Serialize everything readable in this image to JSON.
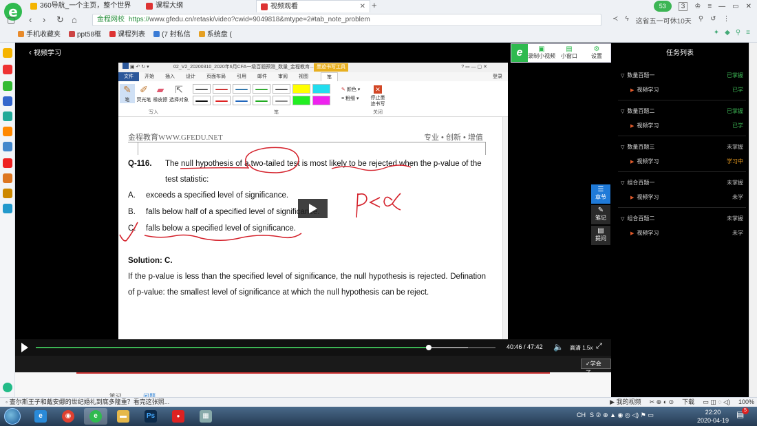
{
  "browser": {
    "tabs": [
      {
        "label": "360导航_一个主页，整个世界"
      },
      {
        "label": "课程大纲"
      },
      {
        "label": "视频观看"
      }
    ],
    "user_badge": "53",
    "tab_count": "3",
    "url_site": "金程网校",
    "url_https": "https://",
    "url_rest": "www.gfedu.cn/retask/video?cwid=9049818&mtype=2#tab_note_problem",
    "search_hint": "这省五一可休10天",
    "bookmarks": [
      "手机收藏夹",
      "ppt58框",
      "课程列表",
      "(7 封私信",
      "系统盘 ("
    ]
  },
  "player": {
    "back_label": "视频学习",
    "toolbar": {
      "record_label": "录制小视频",
      "mini_label": "小窗口",
      "settings_label": "设置"
    },
    "word": {
      "title": "02_V2_20200310_2020年6月CFA一级百题预测_数量_金程教育...",
      "pen_tools_tab": "墨迹书写工具",
      "help": "?",
      "login": "登录",
      "tabs": [
        "文件",
        "开始",
        "插入",
        "设计",
        "页面布局",
        "引用",
        "邮件",
        "审阅",
        "视图",
        "笔"
      ],
      "tools": [
        "笔",
        "荧光笔",
        "橡皮擦",
        "选择对象"
      ],
      "group_write": "写入",
      "group_pens": "笔",
      "group_close": "关闭",
      "color_opt": "颜色",
      "weight_opt": "粗细",
      "stop_label": "停止墨迹书写"
    },
    "doc": {
      "header_left": "金程教育WWW.GFEDU.NET",
      "header_right": "专业 • 创新 • 增值",
      "question_number": "Q-116.",
      "question_text": "The null hypothesis of a two-tailed test is most likely to be rejected when the p-value of the test statistic:",
      "options": [
        {
          "letter": "A.",
          "text": "exceeds a specified level of significance."
        },
        {
          "letter": "B.",
          "text": "falls below half of a specified level of significance."
        },
        {
          "letter": "C.",
          "text": "falls below a specified level of significance."
        }
      ],
      "solution_title": "Solution: C.",
      "solution_text": "If the p-value is less than the specified level of significance, the null hypothesis is rejected. Defination of p-value: the smallest level of significance at which the null hypothesis can be reject."
    },
    "controls": {
      "current_time": "40:46",
      "total_time": "47:42",
      "progress": 0.855,
      "buffered": 0.94,
      "speed_label": "高清 1.5x"
    },
    "learned_label": "✓学会了"
  },
  "side_buttons": [
    {
      "label": "章节"
    },
    {
      "label": "笔记"
    },
    {
      "label": "提问"
    }
  ],
  "task_panel": {
    "title": "任务列表",
    "groups": [
      {
        "name": "数量百题一",
        "status": "已掌握",
        "status_color": "#3cb554",
        "sub": "视频学习",
        "sub_status": "已学",
        "sub_color": "#3cb554"
      },
      {
        "name": "数量百题二",
        "status": "已掌握",
        "status_color": "#3cb554",
        "sub": "视频学习",
        "sub_status": "已学",
        "sub_color": "#3cb554"
      },
      {
        "name": "数量百题三",
        "status": "未掌握",
        "status_color": "#bbbbbb",
        "sub": "视频学习",
        "sub_status": "学习中",
        "sub_color": "#f0a020"
      },
      {
        "name": "组合百题一",
        "status": "未掌握",
        "status_color": "#bbbbbb",
        "sub": "视频学习",
        "sub_status": "未学",
        "sub_color": "#bbbbbb"
      },
      {
        "name": "组合百题二",
        "status": "未掌握",
        "status_color": "#bbbbbb",
        "sub": "视频学习",
        "sub_status": "未学",
        "sub_color": "#bbbbbb"
      }
    ]
  },
  "bottom_tabs": {
    "note": "笔记",
    "ask": "问题"
  },
  "statusbar": {
    "news": "查尔斯王子和戴安娜的世纪婚礼到底多隆重？看完这张照...",
    "my_video": "我的视频",
    "download": "下载",
    "zoom": "100%"
  },
  "taskbar": {
    "time": "22:20",
    "date": "2020-04-19",
    "lang": "CH",
    "notif_count": "5"
  }
}
